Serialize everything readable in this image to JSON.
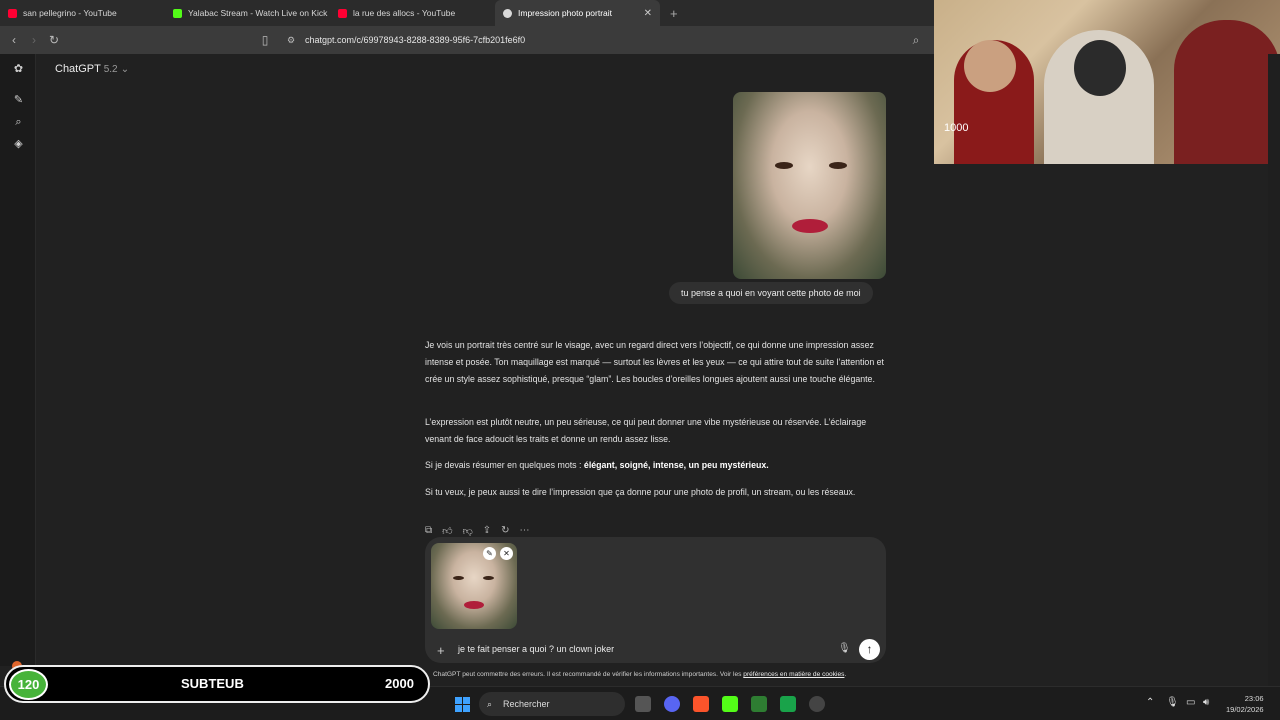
{
  "browser": {
    "tabs": [
      {
        "label": "san pellegrino - YouTube",
        "favicon_color": "#ff0033"
      },
      {
        "label": "Yalabac Stream - Watch Live on Kick",
        "favicon_color": "#53fc18"
      },
      {
        "label": "la rue des allocs - YouTube",
        "favicon_color": "#ff0033"
      },
      {
        "label": "Impression photo portrait",
        "favicon_color": "#d9d9d9",
        "active": true
      }
    ],
    "url": "chatgpt.com/c/69978943-8288-8389-95f6-7cfb201fe6f0"
  },
  "app": {
    "model_name": "ChatGPT",
    "model_version": "5.2",
    "model_chevron": "⌄"
  },
  "conversation": {
    "user_message": "tu pense a quoi en voyant cette photo de moi",
    "assistant_paragraphs": [
      "Je vois un portrait très centré sur le visage, avec un regard direct vers l’objectif, ce qui donne une impression assez intense et posée. Ton maquillage est marqué — surtout les lèvres et les yeux — ce qui attire tout de suite l’attention et crée un style assez sophistiqué, presque “glam”. Les boucles d’oreilles longues ajoutent aussi une touche élégante.",
      "L’expression est plutôt neutre, un peu sérieuse, ce qui peut donner une vibe mystérieuse ou réservée. L’éclairage venant de face adoucit les traits et donne un rendu assez lisse.",
      "Si tu veux, je peux aussi te dire l’impression que ça donne pour une photo de profil, un stream, ou les réseaux."
    ],
    "summary_prefix": "Si je devais résumer en quelques mots : ",
    "summary_bold": "élégant, soigné, intense, un peu mystérieux."
  },
  "composer": {
    "input_value": "je te fait penser a quoi ? un clown joker",
    "disclaimer_text": "ChatGPT peut commettre des erreurs. Il est recommandé de vérifier les informations importantes. Voir les ",
    "disclaimer_link": "préférences en matière de cookies",
    "disclaimer_end": "."
  },
  "webcam": {
    "visible_text": "1000"
  },
  "overlay": {
    "badge_number": "120",
    "name": "SUBTEUB",
    "count": "2000",
    "badge_color": "#47b33a"
  },
  "taskbar": {
    "search_placeholder": "Rechercher",
    "time": "23:06",
    "date": "19/02/2026"
  }
}
